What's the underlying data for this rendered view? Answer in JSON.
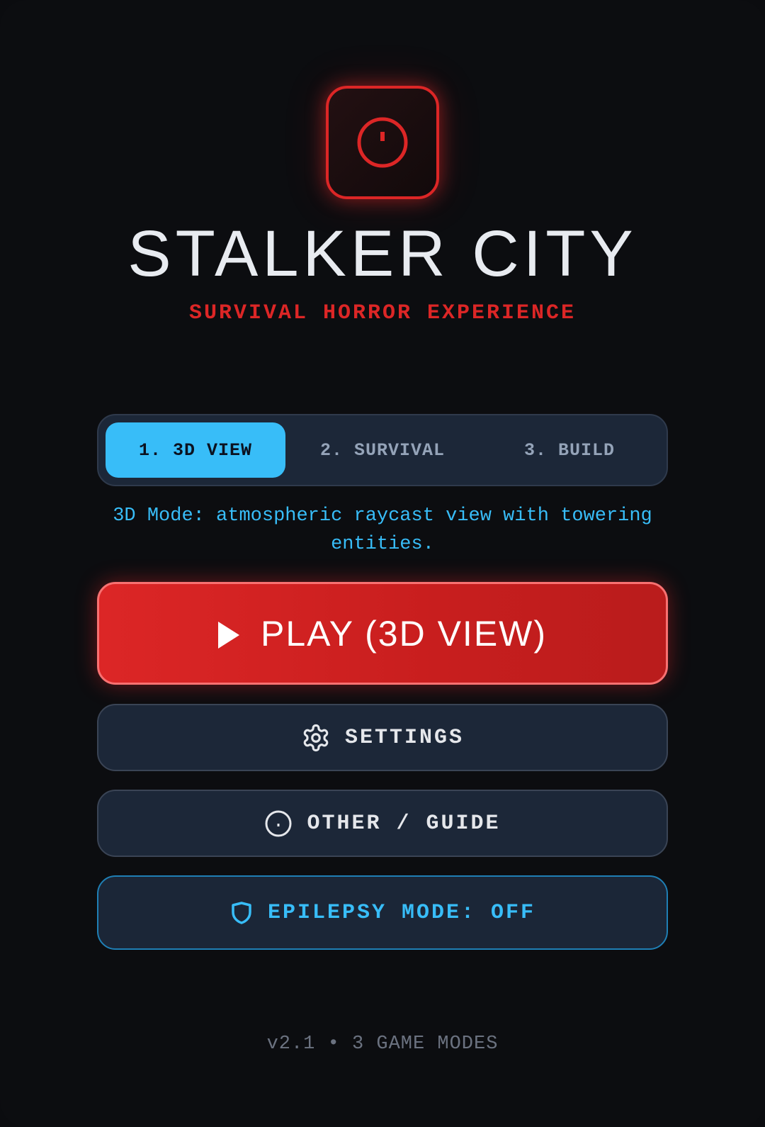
{
  "app": {
    "title": "STALKER CITY",
    "subtitle": "SURVIVAL HORROR EXPERIENCE",
    "logo_icon": "power-icon",
    "accent_color": "#dc2626",
    "info_color": "#38bdf8"
  },
  "mode_tabs": {
    "items": [
      {
        "label": "1. 3D VIEW",
        "active": true
      },
      {
        "label": "2. SURVIVAL",
        "active": false
      },
      {
        "label": "3. BUILD",
        "active": false
      }
    ],
    "description": "3D Mode: atmospheric raycast view with towering entities."
  },
  "menu": {
    "play_label": "PLAY (3D VIEW)",
    "play_icon": "play-icon",
    "settings_label": "SETTINGS",
    "settings_icon": "gear-icon",
    "guide_label": "OTHER / GUIDE",
    "guide_icon": "info-icon",
    "epilepsy_label": "EPILEPSY MODE: OFF",
    "epilepsy_icon": "shield-icon"
  },
  "footer": {
    "version_text": "v2.1 • 3 GAME MODES"
  }
}
